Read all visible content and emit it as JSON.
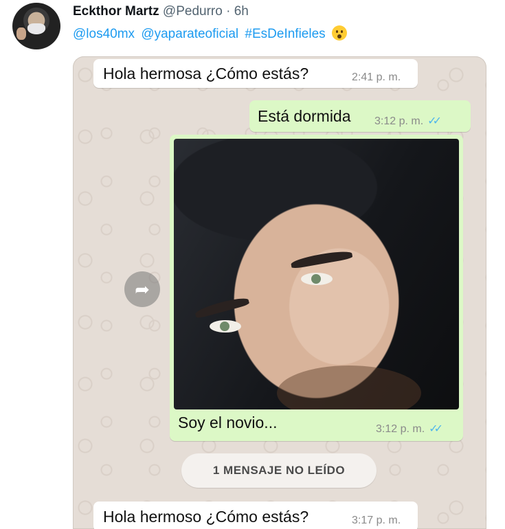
{
  "tweet": {
    "author_name": "Eckthor Martz",
    "author_handle": "@Pedurro",
    "separator": "·",
    "time_ago": "6h",
    "mentions": [
      "@los40mx",
      "@yaparateoficial",
      "#EsDeInfieles"
    ],
    "emoji": "hushed-face"
  },
  "chat": {
    "messages": [
      {
        "direction": "incoming",
        "text": "Hola hermosa ¿Cómo estás?",
        "time": "2:41 p. m."
      },
      {
        "direction": "outgoing",
        "text": "Está dormida",
        "time": "3:12 p. m.",
        "status": "read"
      },
      {
        "direction": "outgoing",
        "type": "photo",
        "caption": "Soy el novio...",
        "time": "3:12 p. m.",
        "status": "read"
      },
      {
        "direction": "incoming",
        "text": "Hola hermoso ¿Cómo estás?",
        "time": "3:17 p. m."
      }
    ],
    "unread_banner": "1 MENSAJE NO LEÍDO",
    "forward_icon": "forward-icon"
  }
}
